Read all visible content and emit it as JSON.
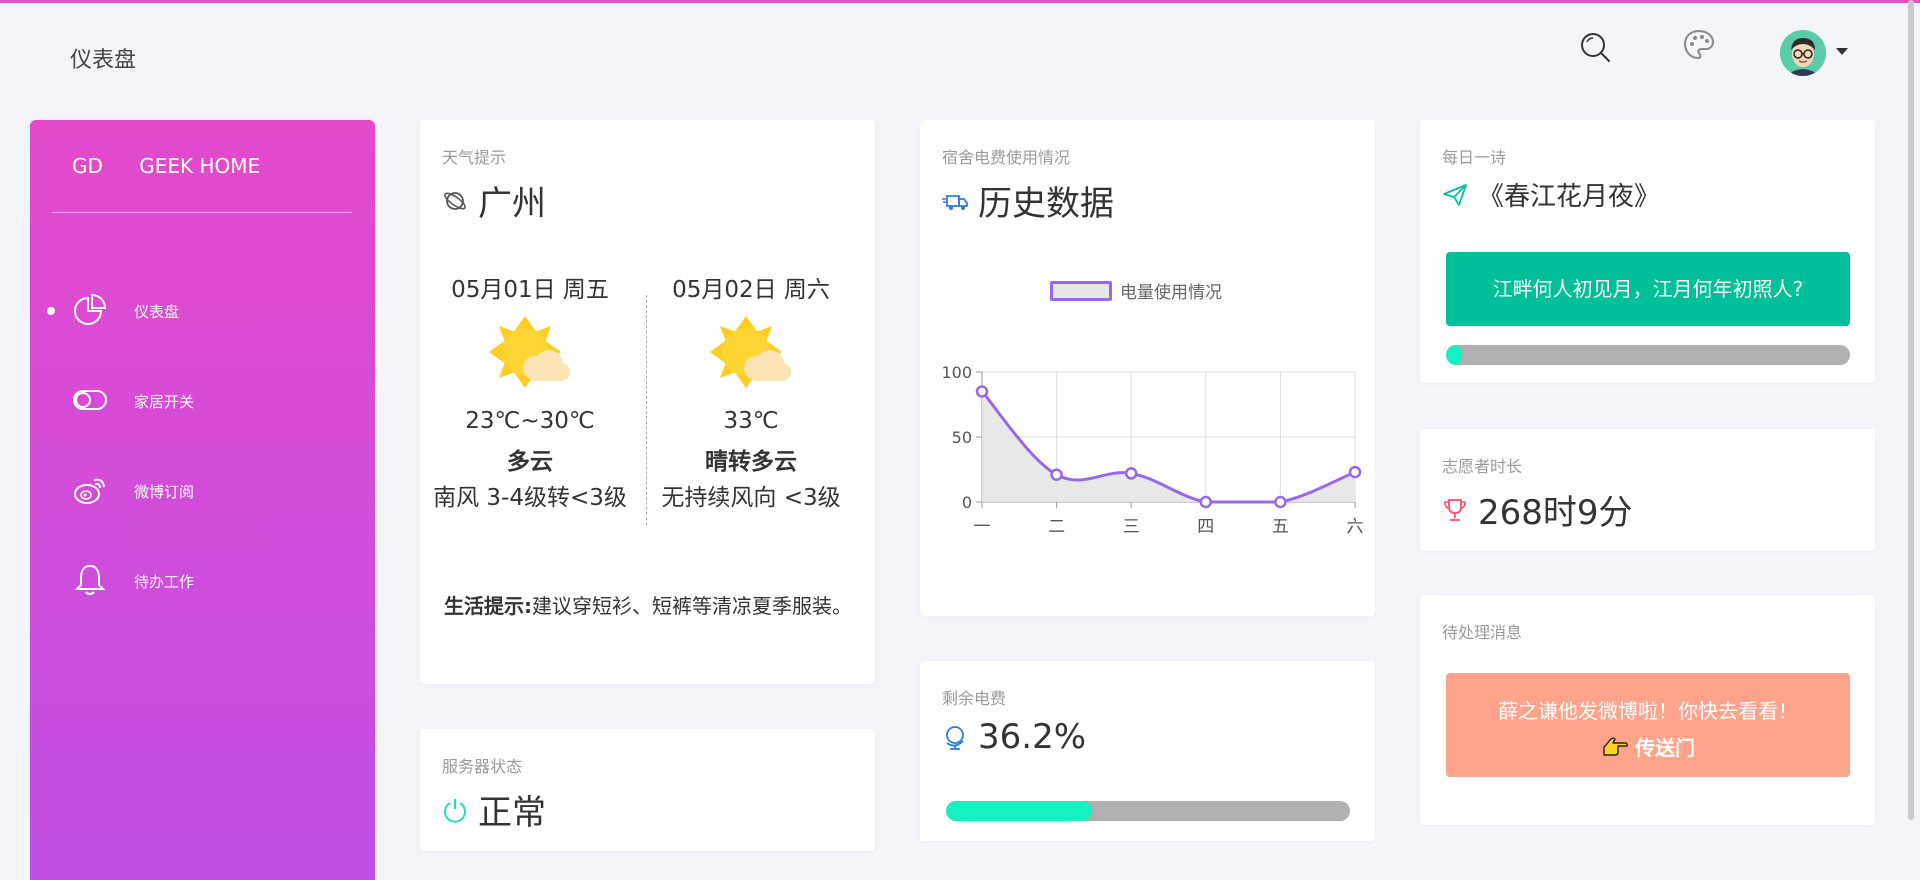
{
  "header": {
    "page_title": "仪表盘",
    "icons": [
      "search-icon",
      "palette-icon"
    ],
    "avatar_icon": "avatar-icon"
  },
  "sidebar": {
    "brand_abbr": "GD",
    "brand_name": "GEEK HOME",
    "items": [
      {
        "label": "仪表盘",
        "icon": "pie-chart-icon",
        "active": true
      },
      {
        "label": "家居开关",
        "icon": "toggle-icon",
        "active": false
      },
      {
        "label": "微博订阅",
        "icon": "weibo-icon",
        "active": false
      },
      {
        "label": "待办工作",
        "icon": "bell-icon",
        "active": false
      }
    ]
  },
  "weather": {
    "category": "天气提示",
    "city": "广州",
    "days": [
      {
        "date": "05月01日 周五",
        "temp": "23℃~30℃",
        "condition": "多云",
        "wind": "南风 3-4级转<3级"
      },
      {
        "date": "05月02日 周六",
        "temp": "33℃",
        "condition": "晴转多云",
        "wind": "无持续风向 <3级"
      }
    ],
    "tips_label": "生活提示:",
    "tips_text": "建议穿短衫、短裤等清凉夏季服装。"
  },
  "server": {
    "category": "服务器状态",
    "status": "正常"
  },
  "electricity": {
    "category": "宿舍电费使用情况",
    "title": "历史数据"
  },
  "chart_data": {
    "type": "area",
    "categories": [
      "一",
      "二",
      "三",
      "四",
      "五",
      "六"
    ],
    "series": [
      {
        "name": "电量使用情况",
        "values": [
          85,
          21,
          22,
          0,
          0,
          23
        ]
      }
    ],
    "ylim": [
      0,
      100
    ],
    "yticks": [
      0,
      50,
      100
    ],
    "grid": true,
    "legend": "top",
    "colors": {
      "line": "#9966ee",
      "fill": "#e6e6e6"
    }
  },
  "balance": {
    "category": "剩余电费",
    "value": "36.2%",
    "fraction": 0.362
  },
  "poem": {
    "category": "每日一诗",
    "title": "《春江花月夜》",
    "line": "江畔何人初见月，江月何年初照人?",
    "progress_fraction": 0.04
  },
  "volunteer": {
    "category": "志愿者时长",
    "value": "268时9分"
  },
  "messages": {
    "category": "待处理消息",
    "text": "薛之谦他发微博啦！你快去看看！",
    "link": "传送门"
  },
  "colors": {
    "sidebar_top": "#e44acc",
    "sidebar_bottom": "#c14fe6",
    "poem_button": "#00bf99",
    "message_button": "#ffa38a",
    "progress_fill": "#17f0c3",
    "progress_track": "#b0b0b0"
  }
}
